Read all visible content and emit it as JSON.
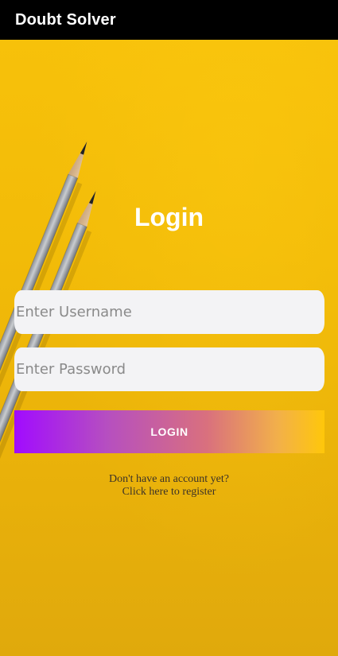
{
  "app_bar": {
    "title": "Doubt Solver"
  },
  "login": {
    "heading": "Login",
    "username_placeholder": "Enter Username",
    "password_placeholder": "Enter Password",
    "username_value": "",
    "password_value": "",
    "button_label": "LOGIN",
    "register_line1": "Don't have an account yet?",
    "register_line2": "Click here to register"
  },
  "colors": {
    "app_bar_bg": "#000000",
    "background_yellow": "#f2bb08",
    "button_gradient_start": "#a10bff",
    "button_gradient_end": "#ffc70a",
    "input_bg": "#f3f3f5",
    "heading_text": "#ffffff"
  },
  "background": {
    "image": "pencils-on-yellow"
  }
}
